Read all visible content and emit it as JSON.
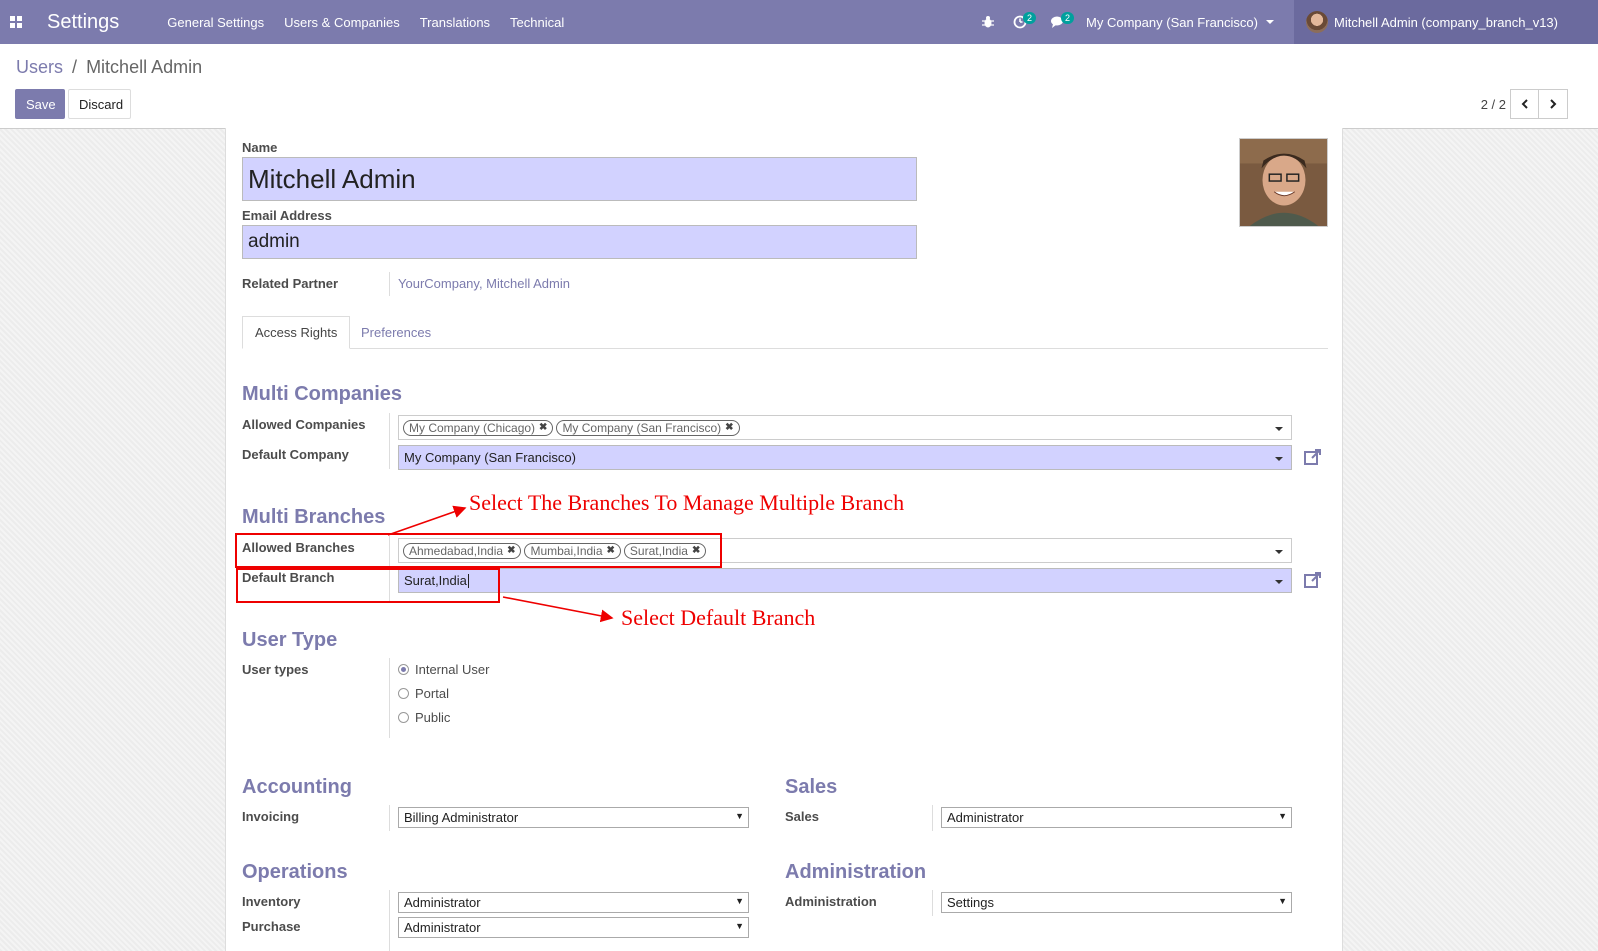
{
  "navbar": {
    "app_title": "Settings",
    "menu": [
      "General Settings",
      "Users & Companies",
      "Translations",
      "Technical"
    ],
    "activity_count": "2",
    "message_count": "2",
    "company_switcher": "My Company (San Francisco)",
    "user_name": "Mitchell Admin (company_branch_v13)",
    "accent_color": "#7c7bad"
  },
  "control": {
    "breadcrumb_parent": "Users",
    "breadcrumb_sep": "/",
    "breadcrumb_current": "Mitchell Admin",
    "save_label": "Save",
    "discard_label": "Discard",
    "pager": "2 / 2"
  },
  "form": {
    "name_label": "Name",
    "name_value": "Mitchell Admin",
    "email_label": "Email Address",
    "email_value": "admin",
    "partner_label": "Related Partner",
    "partner_value": "YourCompany, Mitchell Admin",
    "tabs": [
      "Access Rights",
      "Preferences"
    ],
    "multi_companies": {
      "title": "Multi Companies",
      "allowed_label": "Allowed Companies",
      "allowed_tags": [
        "My Company (Chicago)",
        "My Company (San Francisco)"
      ],
      "default_label": "Default Company",
      "default_value": "My Company (San Francisco)"
    },
    "multi_branches": {
      "title": "Multi Branches",
      "allowed_label": "Allowed Branches",
      "allowed_tags": [
        "Ahmedabad,India",
        "Mumbai,India",
        "Surat,India"
      ],
      "default_label": "Default Branch",
      "default_value": "Surat,India"
    },
    "user_type": {
      "title": "User Type",
      "label": "User types",
      "options": [
        "Internal User",
        "Portal",
        "Public"
      ],
      "selected": "Internal User"
    },
    "accounting": {
      "title": "Accounting",
      "label": "Invoicing",
      "value": "Billing Administrator"
    },
    "sales": {
      "title": "Sales",
      "label": "Sales",
      "value": "Administrator"
    },
    "operations": {
      "title": "Operations",
      "inventory_label": "Inventory",
      "inventory_value": "Administrator",
      "purchase_label": "Purchase",
      "purchase_value": "Administrator"
    },
    "administration": {
      "title": "Administration",
      "label": "Administration",
      "value": "Settings"
    }
  },
  "annotations": {
    "branches_note": "Select The Branches To Manage Multiple Branch",
    "default_note": "Select Default Branch",
    "color": "#e00000"
  }
}
